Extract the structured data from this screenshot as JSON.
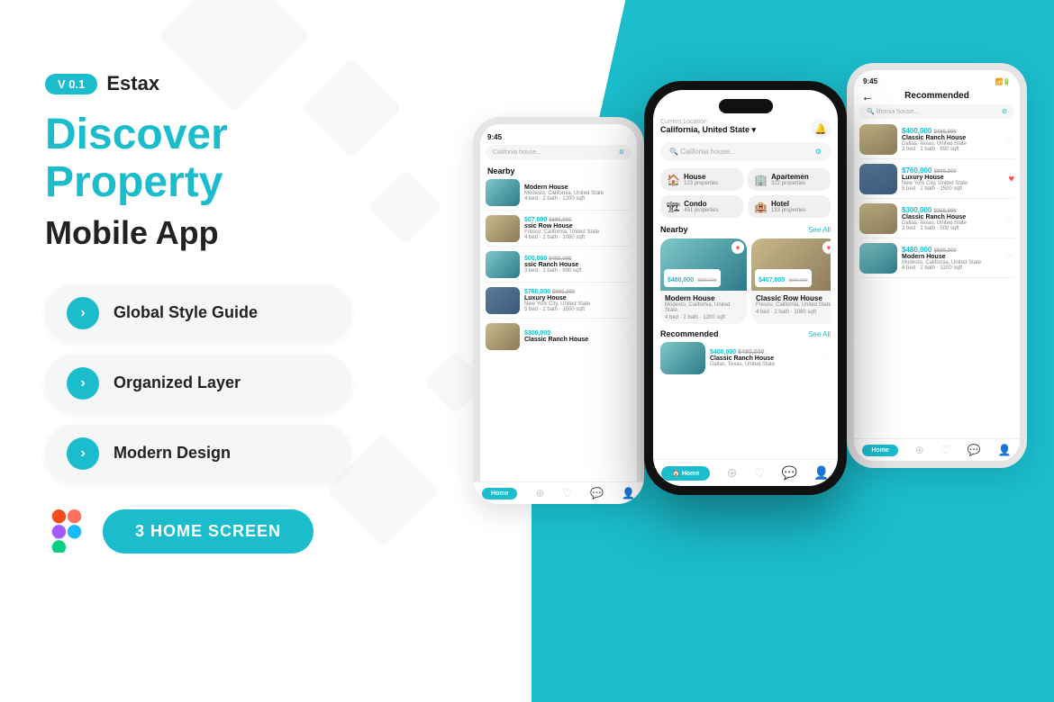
{
  "app": {
    "version": "V 0.1",
    "brand": "Estax",
    "headline": "Discover Property",
    "subheadline": "Mobile App",
    "features": [
      {
        "id": "global-style",
        "label": "Global Style Guide"
      },
      {
        "id": "organized-layer",
        "label": "Organized Layer"
      },
      {
        "id": "modern-design",
        "label": "Modern Design"
      }
    ],
    "cta": "3 HOME SCREEN",
    "figma_label": "Figma Icon"
  },
  "phone_main": {
    "time": "9:45",
    "location_label": "Current Location",
    "location_value": "California, United State",
    "search_placeholder": "Califonia house...",
    "categories": [
      {
        "name": "House",
        "count": "123 properties"
      },
      {
        "name": "Apartemen",
        "count": "322 properties"
      },
      {
        "name": "Condo",
        "count": "451 properties"
      },
      {
        "name": "Hotel",
        "count": "133 properties"
      }
    ],
    "nearby_label": "Nearby",
    "see_all": "See All",
    "cards": [
      {
        "price": "$480,000",
        "old_price": "$580,000",
        "name": "Modern House",
        "location": "Modesto, California, United State",
        "bed": "4 bed",
        "bath": "2 bath",
        "sqft": "1200 sqft",
        "liked": true
      },
      {
        "price": "$407,000",
        "old_price": "$690,000",
        "name": "Classic Row House",
        "location": "Fresno, California, United State",
        "bed": "4 bed",
        "bath": "2 bath",
        "sqft": "1080 sqft",
        "liked": true
      }
    ],
    "recommended_label": "Recommended",
    "nav_home": "Home"
  },
  "phone_recommended": {
    "time": "9:45",
    "title": "Recommended",
    "search_placeholder": "lifornia house...",
    "items": [
      {
        "price": "$400,000",
        "old_price": "$480,000",
        "name": "Classic Ranch House",
        "location": "Dallas, Texas, United State",
        "bed": "3 bed",
        "bath": "1 bath",
        "sqft": "890 sqft",
        "liked": false,
        "img_type": "ranch"
      },
      {
        "price": "$760,000",
        "old_price": "$900,000",
        "name": "Luxury House",
        "location": "New York City, United State",
        "bed": "5 bed",
        "bath": "2 bath",
        "sqft": "1500 sqft",
        "liked": true,
        "img_type": "luxury"
      },
      {
        "price": "$300,000",
        "old_price": "$350,000",
        "name": "Classic Ranch House",
        "location": "Dallas, Texas, United State",
        "bed": "3 bed",
        "bath": "1 bath",
        "sqft": "500 sqft",
        "liked": false,
        "img_type": "ranch"
      },
      {
        "price": "$480,000",
        "old_price": "$580,000",
        "name": "Modern House",
        "location": "Modesto, California, United State",
        "bed": "4 bed",
        "bath": "2 bath",
        "sqft": "1200 sqft",
        "liked": false,
        "img_type": "modern"
      }
    ],
    "nav_home": "Home"
  },
  "phone_nearby": {
    "time": "9:45",
    "nearby_label": "Nearby",
    "items": [
      {
        "name": "Modern House",
        "location": "Modesto, California, United State",
        "bed": "4 bed",
        "bath": "2 bath",
        "sqft": "1200 sqft"
      },
      {
        "price": "$07,000",
        "old_price": "$690,000",
        "name": "ssic Row House",
        "location": "Fresco, California, United State",
        "bed": "4 bed",
        "bath": "2 bath",
        "sqft": "1080 sqft",
        "liked": false
      },
      {
        "price": "$00,000",
        "old_price": "$480,000",
        "name": "ssic Ranch House",
        "bed": "3 bed",
        "bath": "1 bath",
        "sqft": "890 sqft"
      },
      {
        "price": "$760,000",
        "old_price": "$900,000",
        "name": "Luxury House",
        "location": "New York City, United State",
        "bed": "5 bed",
        "bath": "2 bath",
        "sqft": "1500 sqft"
      },
      {
        "price": "$300,000",
        "old_price": "$350,000",
        "name": "Classic Ranch House"
      }
    ]
  },
  "colors": {
    "teal": "#1bbccc",
    "dark": "#111111",
    "light_bg": "#f5f6f7",
    "white": "#ffffff"
  }
}
